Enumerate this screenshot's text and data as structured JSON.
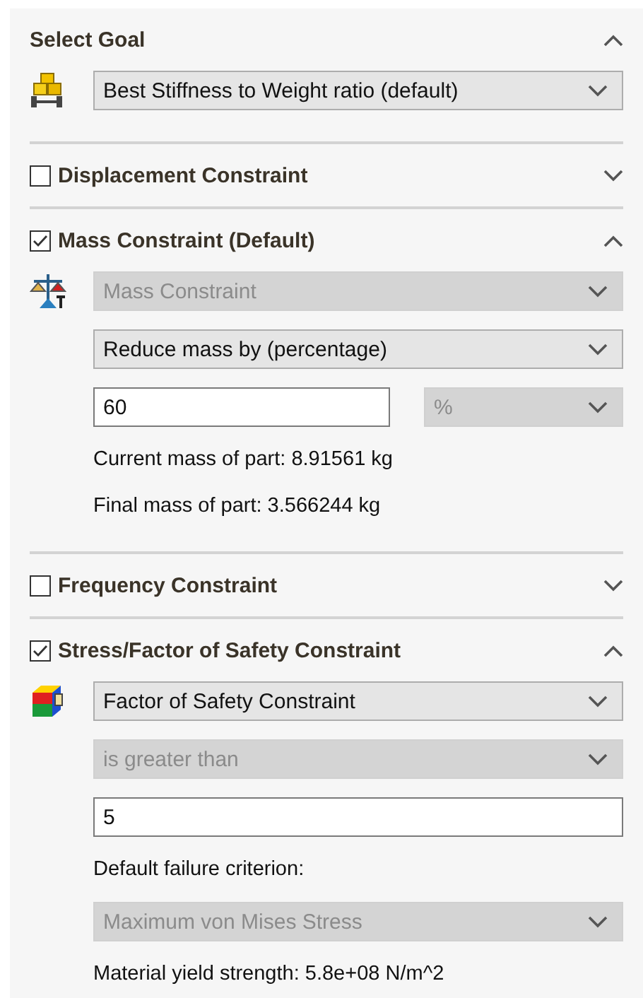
{
  "sections": [
    {
      "kind": "plain",
      "title": "Select Goal",
      "expanded": true,
      "rows": [
        {
          "kind": "select",
          "value": "Best Stiffness to Weight ratio (default)",
          "disabled": false
        }
      ]
    },
    {
      "kind": "checkbox",
      "title": "Displacement Constraint",
      "checked": false,
      "expanded": false
    },
    {
      "kind": "checkbox",
      "title": "Mass Constraint (Default)",
      "checked": true,
      "expanded": true,
      "rows": [
        {
          "kind": "select",
          "value": "Mass Constraint",
          "disabled": true
        },
        {
          "kind": "select",
          "value": "Reduce mass by (percentage)",
          "disabled": false
        },
        {
          "kind": "input-select",
          "value": "60",
          "unit": "%",
          "unit_disabled": true
        },
        {
          "kind": "text",
          "text": "Current mass of part: 8.91561 kg"
        },
        {
          "kind": "text",
          "text": "Final mass of part: 3.566244 kg"
        }
      ]
    },
    {
      "kind": "checkbox",
      "title": "Frequency Constraint",
      "checked": false,
      "expanded": false
    },
    {
      "kind": "checkbox",
      "title": "Stress/Factor of Safety Constraint",
      "checked": true,
      "expanded": true,
      "rows": [
        {
          "kind": "select",
          "value": "Factor of Safety Constraint",
          "disabled": false
        },
        {
          "kind": "select",
          "value": "is greater than",
          "disabled": true
        },
        {
          "kind": "input",
          "value": "5"
        },
        {
          "kind": "text",
          "text": "Default failure criterion:"
        },
        {
          "kind": "select",
          "value": "Maximum von Mises Stress",
          "disabled": true
        },
        {
          "kind": "text",
          "text": "Material yield strength: 5.8e+08 N/m^2"
        }
      ]
    }
  ]
}
